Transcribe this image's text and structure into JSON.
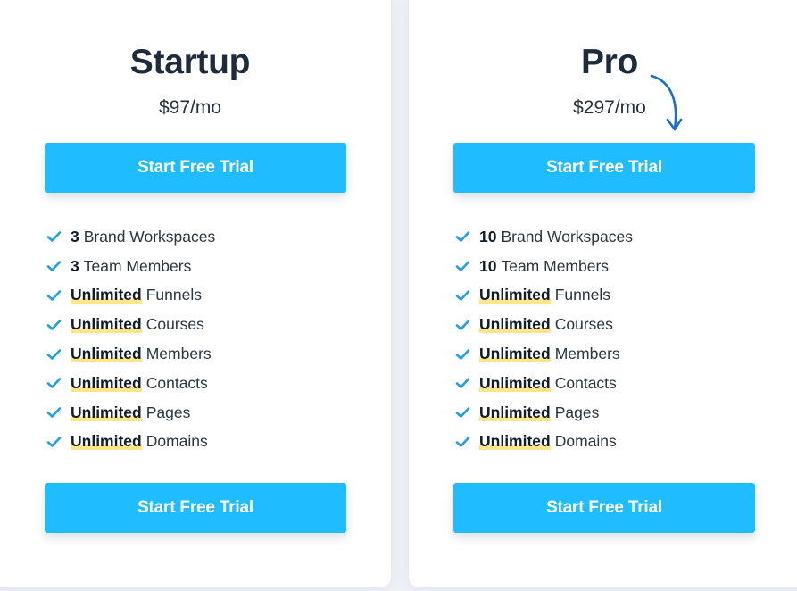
{
  "colors": {
    "accent": "#1fbcff",
    "highlight": "#fde68a",
    "check": "#1e9fe8",
    "arrow": "#1a6fd6",
    "heading": "#1d2b3a",
    "background": "#eef1f6"
  },
  "plans": [
    {
      "name": "Startup",
      "price": "$97/mo",
      "cta_top": "Start Free Trial",
      "cta_bottom": "Start Free Trial",
      "features": [
        {
          "bold": "3",
          "text": "Brand Workspaces",
          "highlight": false
        },
        {
          "bold": "3",
          "text": "Team Members",
          "highlight": false
        },
        {
          "bold": "Unlimited",
          "text": "Funnels",
          "highlight": true
        },
        {
          "bold": "Unlimited",
          "text": "Courses",
          "highlight": true
        },
        {
          "bold": "Unlimited",
          "text": "Members",
          "highlight": true
        },
        {
          "bold": "Unlimited",
          "text": "Contacts",
          "highlight": true
        },
        {
          "bold": "Unlimited",
          "text": "Pages",
          "highlight": true
        },
        {
          "bold": "Unlimited",
          "text": "Domains",
          "highlight": true
        }
      ]
    },
    {
      "name": "Pro",
      "price": "$297/mo",
      "cta_top": "Start Free Trial",
      "cta_bottom": "Start Free Trial",
      "features": [
        {
          "bold": "10",
          "text": "Brand Workspaces",
          "highlight": false
        },
        {
          "bold": "10",
          "text": "Team Members",
          "highlight": false
        },
        {
          "bold": "Unlimited",
          "text": "Funnels",
          "highlight": true
        },
        {
          "bold": "Unlimited",
          "text": "Courses",
          "highlight": true
        },
        {
          "bold": "Unlimited",
          "text": "Members",
          "highlight": true
        },
        {
          "bold": "Unlimited",
          "text": "Contacts",
          "highlight": true
        },
        {
          "bold": "Unlimited",
          "text": "Pages",
          "highlight": true
        },
        {
          "bold": "Unlimited",
          "text": "Domains",
          "highlight": true
        }
      ]
    }
  ],
  "icons": {
    "check": "checkmark-icon",
    "arrow": "curved-arrow-down-icon"
  }
}
